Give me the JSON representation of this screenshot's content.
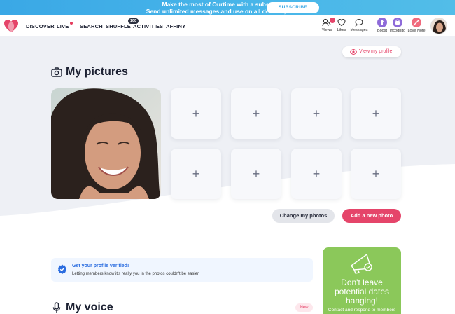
{
  "banner": {
    "line1": "Make the most of Ourtime with a subscription!",
    "line2": "Send unlimited messages and use on all devices, ad-free.",
    "subscribe_label": "SUBSCRIBE"
  },
  "nav": {
    "items": [
      {
        "label": "DISCOVER"
      },
      {
        "label": "LIVE"
      },
      {
        "label": "SEARCH"
      },
      {
        "label": "SHUFFLE",
        "badge": "100"
      },
      {
        "label": "ACTIVITIES"
      },
      {
        "label": "AFFINY"
      }
    ],
    "icons": [
      {
        "label": "Views",
        "icon": "views-icon"
      },
      {
        "label": "Likes",
        "icon": "heart-icon"
      },
      {
        "label": "Messages",
        "icon": "chat-icon"
      },
      {
        "label": "Boost",
        "icon": "boost-icon",
        "color": "#8e6bd9"
      },
      {
        "label": "Incognito",
        "icon": "incognito-icon",
        "color": "#8e6bd9"
      },
      {
        "label": "Love Note",
        "icon": "love-note-icon",
        "color": "#f06a7d"
      }
    ]
  },
  "profile": {
    "view_profile_label": "View my profile"
  },
  "pictures": {
    "title": "My pictures",
    "add_slot_symbol": "+",
    "change_photos_label": "Change my photos",
    "add_photo_label": "Add a new photo"
  },
  "verify": {
    "title": "Get your profile verified!",
    "description": "Letting members know it's really you in the photos couldn't be easier."
  },
  "promo": {
    "line1": "Don't leave",
    "line2": "potential dates",
    "line3": "hanging!",
    "sub": "Contact and respond to members"
  },
  "voice": {
    "title": "My voice",
    "badge": "New"
  },
  "colors": {
    "accent": "#e5456a",
    "banner": "#3aa8e6",
    "promo": "#8bc85a",
    "verify_blue": "#2b6de0"
  }
}
